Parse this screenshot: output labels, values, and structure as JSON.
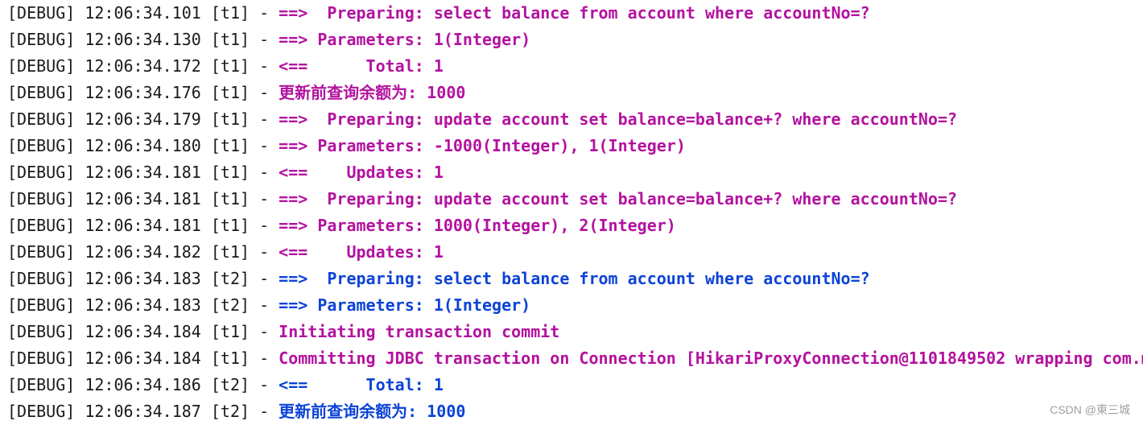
{
  "colors": {
    "t1": "#b3129f",
    "t2": "#0c43d6",
    "prefix": "#1a1a1a"
  },
  "lines": [
    {
      "prefix": "[DEBUG] 12:06:34.101 [t1] - ",
      "message": "==>  Preparing: select balance from account where accountNo=?",
      "thread": "t1"
    },
    {
      "prefix": "[DEBUG] 12:06:34.130 [t1] - ",
      "message": "==> Parameters: 1(Integer)",
      "thread": "t1"
    },
    {
      "prefix": "[DEBUG] 12:06:34.172 [t1] - ",
      "message": "<==      Total: 1",
      "thread": "t1"
    },
    {
      "prefix": "[DEBUG] 12:06:34.176 [t1] - ",
      "message": "更新前查询余额为: 1000",
      "thread": "t1"
    },
    {
      "prefix": "[DEBUG] 12:06:34.179 [t1] - ",
      "message": "==>  Preparing: update account set balance=balance+? where accountNo=?",
      "thread": "t1"
    },
    {
      "prefix": "[DEBUG] 12:06:34.180 [t1] - ",
      "message": "==> Parameters: -1000(Integer), 1(Integer)",
      "thread": "t1"
    },
    {
      "prefix": "[DEBUG] 12:06:34.181 [t1] - ",
      "message": "<==    Updates: 1",
      "thread": "t1"
    },
    {
      "prefix": "[DEBUG] 12:06:34.181 [t1] - ",
      "message": "==>  Preparing: update account set balance=balance+? where accountNo=?",
      "thread": "t1"
    },
    {
      "prefix": "[DEBUG] 12:06:34.181 [t1] - ",
      "message": "==> Parameters: 1000(Integer), 2(Integer)",
      "thread": "t1"
    },
    {
      "prefix": "[DEBUG] 12:06:34.182 [t1] - ",
      "message": "<==    Updates: 1",
      "thread": "t1"
    },
    {
      "prefix": "[DEBUG] 12:06:34.183 [t2] - ",
      "message": "==>  Preparing: select balance from account where accountNo=?",
      "thread": "t2"
    },
    {
      "prefix": "[DEBUG] 12:06:34.183 [t2] - ",
      "message": "==> Parameters: 1(Integer)",
      "thread": "t2"
    },
    {
      "prefix": "[DEBUG] 12:06:34.184 [t1] - ",
      "message": "Initiating transaction commit",
      "thread": "t1"
    },
    {
      "prefix": "[DEBUG] 12:06:34.184 [t1] - ",
      "message": "Committing JDBC transaction on Connection [HikariProxyConnection@1101849502 wrapping com.m",
      "thread": "t1"
    },
    {
      "prefix": "[DEBUG] 12:06:34.186 [t2] - ",
      "message": "<==      Total: 1",
      "thread": "t2"
    },
    {
      "prefix": "[DEBUG] 12:06:34.187 [t2] - ",
      "message": "更新前查询余额为: 1000",
      "thread": "t2"
    }
  ],
  "watermark": "CSDN @東三城"
}
